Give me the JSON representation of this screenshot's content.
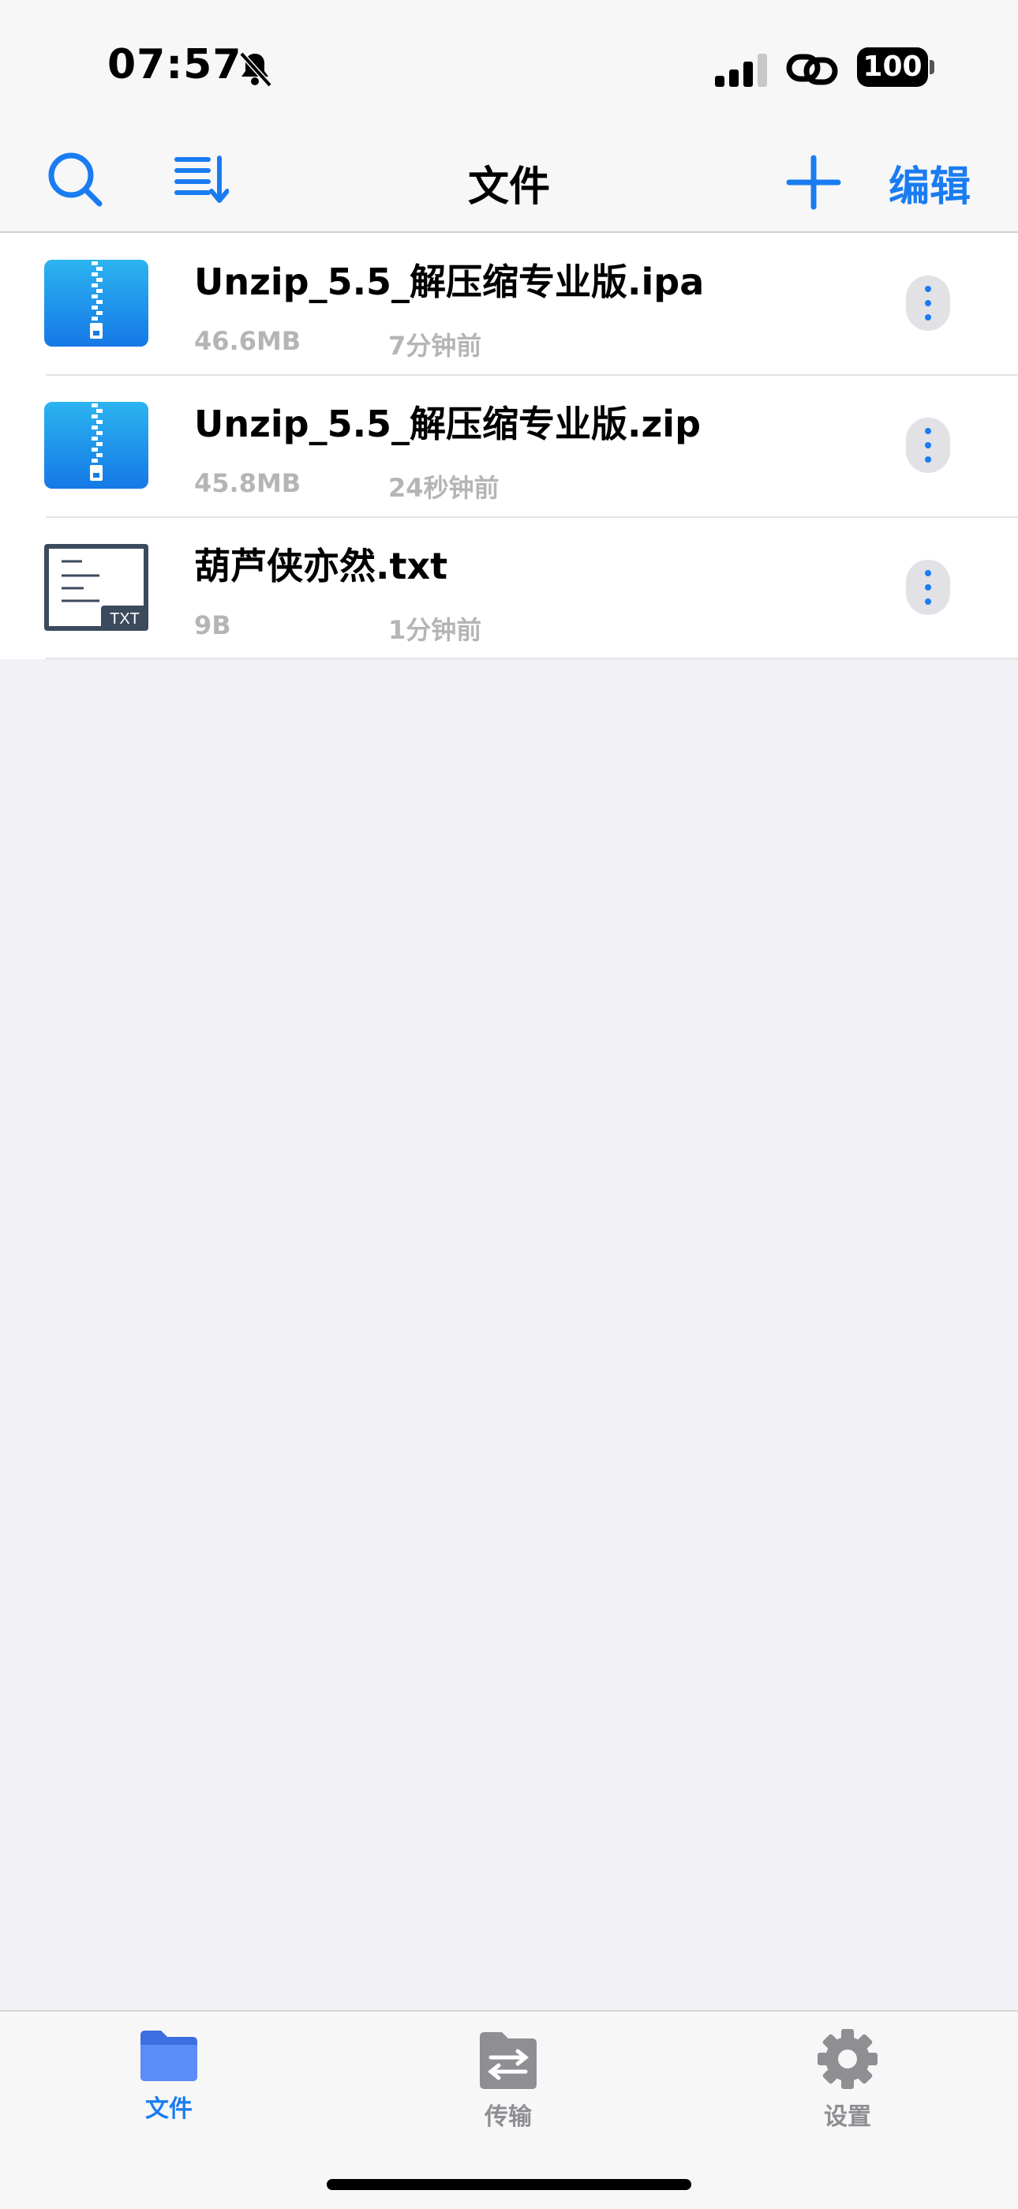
{
  "status_bar": {
    "time": "07:57",
    "battery": "100"
  },
  "nav": {
    "title": "文件",
    "edit_label": "编辑"
  },
  "files": [
    {
      "name": "Unzip_5.5_解压缩专业版.ipa",
      "size": "46.6MB",
      "time": "7分钟前",
      "type": "zip-icon"
    },
    {
      "name": "Unzip_5.5_解压缩专业版.zip",
      "size": "45.8MB",
      "time": "24秒钟前",
      "type": "zip-icon"
    },
    {
      "name": "葫芦侠亦然.txt",
      "size": "9B",
      "time": "1分钟前",
      "type": "txt-icon",
      "badge": "TXT"
    }
  ],
  "tabs": [
    {
      "label": "文件",
      "icon": "folder-icon",
      "active": true
    },
    {
      "label": "传输",
      "icon": "transfer-icon",
      "active": false
    },
    {
      "label": "设置",
      "icon": "gear-icon",
      "active": false
    }
  ],
  "colors": {
    "accent": "#1a7cf2",
    "background": "#f1f1f6",
    "secondary_text": "#b5b5b8"
  }
}
